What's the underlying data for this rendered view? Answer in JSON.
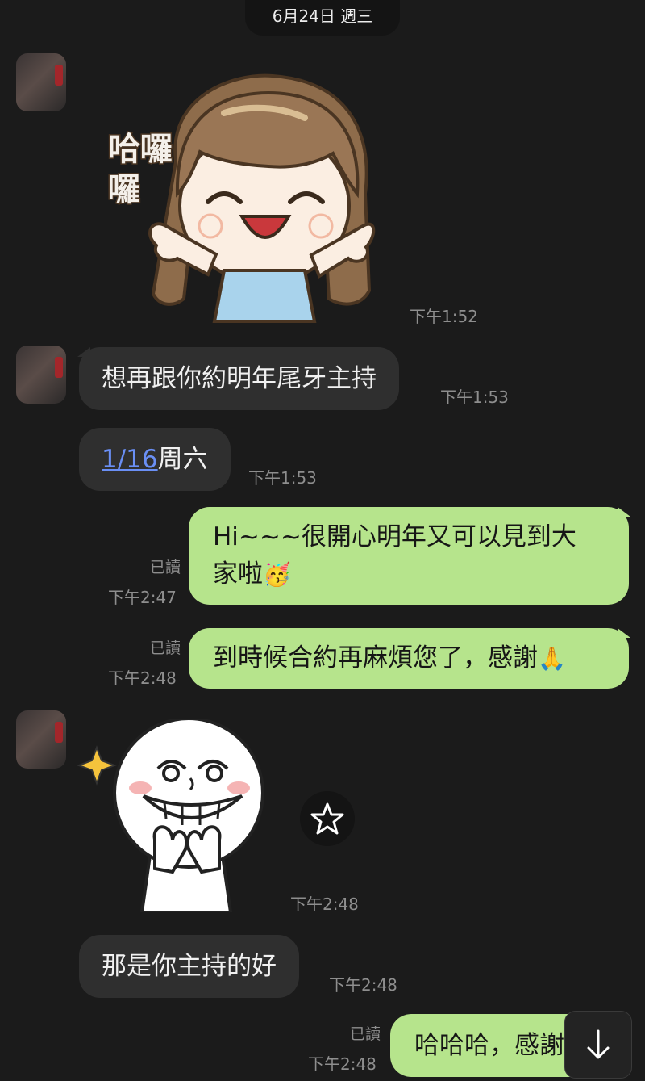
{
  "chat": {
    "date_label": "6月24日 週三",
    "messages": [
      {
        "id": "m1",
        "type": "sticker",
        "side": "in",
        "sticker_text": "哈囉",
        "time": "下午1:52"
      },
      {
        "id": "m2",
        "type": "text",
        "side": "in",
        "text": "想再跟你約明年尾牙主持",
        "time": "下午1:53"
      },
      {
        "id": "m3",
        "type": "text",
        "side": "in",
        "link_text": "1/16",
        "text": "周六",
        "time": "下午1:53"
      },
      {
        "id": "m4",
        "type": "text",
        "side": "out",
        "text_line1": "Hi~~~很開心明年又可以見到大",
        "text_line2": "家啦",
        "emoji": "🥳",
        "read": "已讀",
        "time": "下午2:47"
      },
      {
        "id": "m5",
        "type": "text",
        "side": "out",
        "text": "到時候合約再麻煩您了，感謝",
        "emoji": "🙏",
        "read": "已讀",
        "time": "下午2:48"
      },
      {
        "id": "m6",
        "type": "sticker",
        "side": "in",
        "time": "下午2:48"
      },
      {
        "id": "m7",
        "type": "text",
        "side": "in",
        "text": "那是你主持的好",
        "time": "下午2:48"
      },
      {
        "id": "m8",
        "type": "text",
        "side": "out",
        "text": "哈哈哈，感謝",
        "read": "已讀",
        "time": "下午2:48"
      }
    ]
  },
  "icons": {
    "star": "star-icon",
    "scroll_down": "arrow-down-icon",
    "sparkle": "sparkle-icon"
  },
  "colors": {
    "background": "#1b1b1b",
    "incoming_bubble": "#2f2f2f",
    "outgoing_bubble": "#b6e48c",
    "link": "#6a8ff5"
  }
}
